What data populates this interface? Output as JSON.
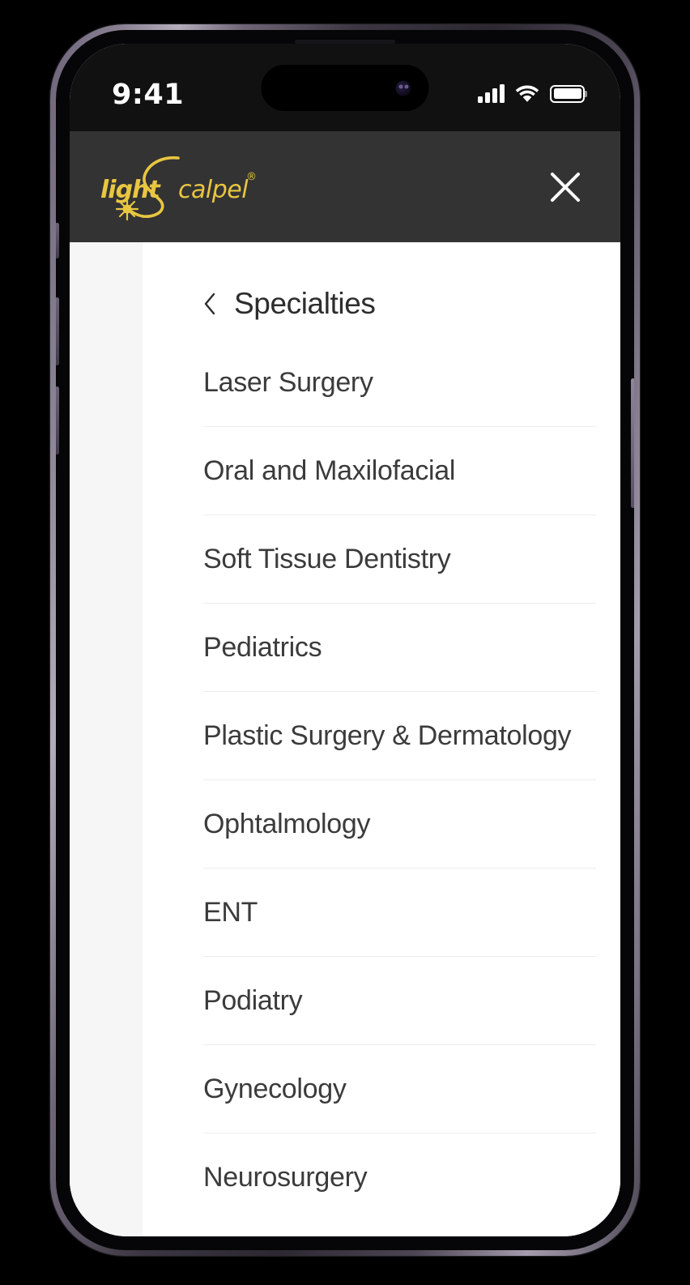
{
  "device": {
    "status_bar": {
      "time": "9:41",
      "cellular_icon": "signal-bars-icon",
      "wifi_icon": "wifi-icon",
      "battery_icon": "battery-full-icon"
    },
    "buttons": {
      "silent_switch": "silent-switch",
      "volume_up": "volume-up-button",
      "volume_down": "volume-down-button",
      "power": "power-button"
    }
  },
  "header": {
    "logo_text_left": "light",
    "logo_text_right": "calpel",
    "logo_registered_mark": "®",
    "logo_alt": "LightScalpel",
    "logo_color": "#e8c640",
    "background_color": "#333333",
    "close_label": "Close menu",
    "close_icon": "close-icon"
  },
  "menu": {
    "back_icon": "chevron-left-icon",
    "back_label": "Specialties",
    "items": [
      {
        "label": "Laser Surgery"
      },
      {
        "label": "Oral and Maxilofacial"
      },
      {
        "label": "Soft Tissue Dentistry"
      },
      {
        "label": "Pediatrics"
      },
      {
        "label": "Plastic Surgery & Dermatology"
      },
      {
        "label": "Ophtalmology"
      },
      {
        "label": "ENT"
      },
      {
        "label": "Podiatry"
      },
      {
        "label": "Gynecology"
      },
      {
        "label": "Neurosurgery"
      }
    ],
    "panel_background": "#ffffff",
    "previous_panel_background": "#f6f6f7",
    "divider_color": "#ededee",
    "text_color": "#3b3b3b"
  }
}
